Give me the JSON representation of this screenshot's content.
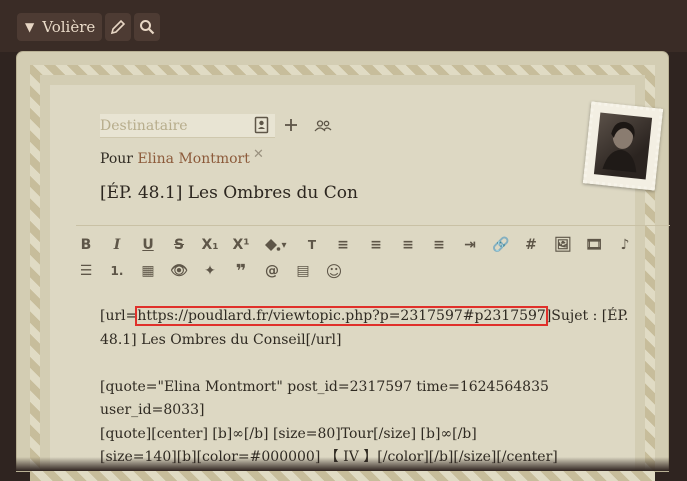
{
  "topbar": {
    "menu_label": "Volière",
    "icons": [
      "caret-down-icon",
      "pencil-icon",
      "search-icon"
    ]
  },
  "form": {
    "recipient_placeholder": "Destinataire",
    "recipient_prefix": "Pour",
    "recipient_name": "Elina Montmort",
    "remove_symbol": "✕",
    "subject": "[ÉP. 48.1] Les Ombres du Con"
  },
  "toolbar": {
    "row1": [
      "B",
      "I",
      "U",
      "S",
      "X₁",
      "X¹",
      "▾",
      "T",
      "≡",
      "≡",
      "≡",
      "≡",
      "⇥",
      "🔗",
      "#",
      "🖼",
      "🎞",
      "♪"
    ],
    "row2": [
      "☰",
      "1.",
      "▦",
      "👁",
      "✦",
      "❞",
      "@",
      "▤",
      "☺"
    ]
  },
  "editor": {
    "lines": [
      {
        "pre": "[url=",
        "link": "https://poudlard.fr/viewtopic.php?p=2317597#p2317597",
        "post": "]Sujet : [ÉP."
      },
      {
        "pre": "48.1] Les Ombres du Conseil[/url]"
      },
      {
        "pre": ""
      },
      {
        "pre": "[quote=\"Elina Montmort\" post_id=2317597 time=1624564835"
      },
      {
        "pre": "user_id=8033]"
      },
      {
        "pre": "[quote][center] [b]∞[/b] [size=80]Tour[/size] [b]∞[/b]"
      },
      {
        "pre": "[size=140][b][color=#000000] 【 IV 】[/color][/b][/size][/center]"
      }
    ]
  },
  "colors": {
    "accent_highlight": "#e0302a",
    "recipient_name": "#8c5a3a"
  }
}
